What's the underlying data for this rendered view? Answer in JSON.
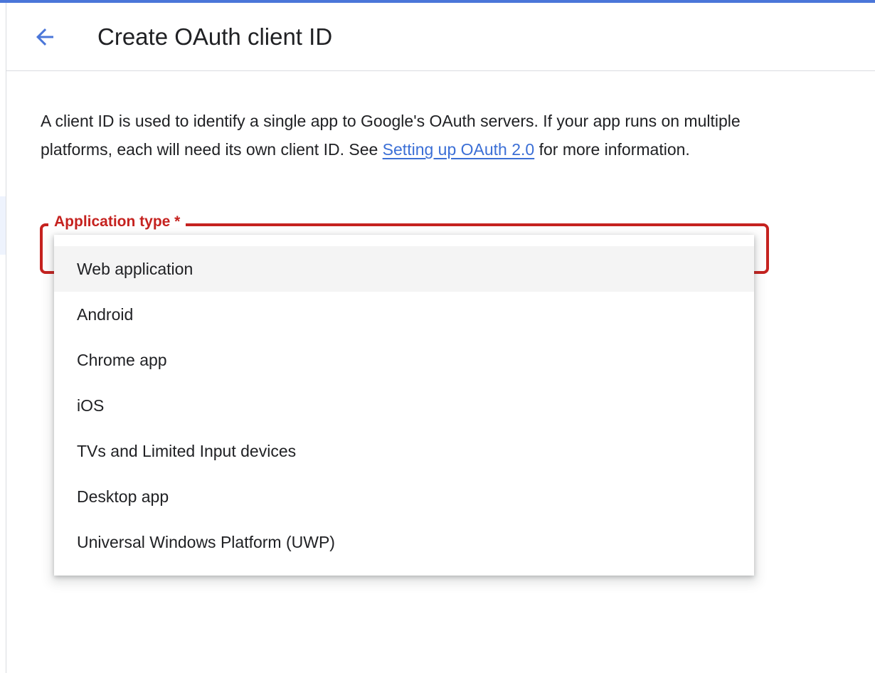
{
  "header": {
    "back_icon": "arrow-back-icon",
    "title": "Create OAuth client ID"
  },
  "intro": {
    "text_before_link": "A client ID is used to identify a single app to Google's OAuth servers. If your app runs on multiple platforms, each will need its own client ID. See ",
    "link_text": "Setting up OAuth 2.0",
    "text_after_link": " for more information."
  },
  "application_type": {
    "label": "Application type *",
    "highlighted_option": "Web application",
    "options": [
      "Web application",
      "Android",
      "Chrome app",
      "iOS",
      "TVs and Limited Input devices",
      "Desktop app",
      "Universal Windows Platform (UWP)"
    ]
  },
  "colors": {
    "accent_blue": "#4a76d9",
    "link_blue": "#3b6fd6",
    "error_red": "#c5221f",
    "text": "#202124"
  }
}
